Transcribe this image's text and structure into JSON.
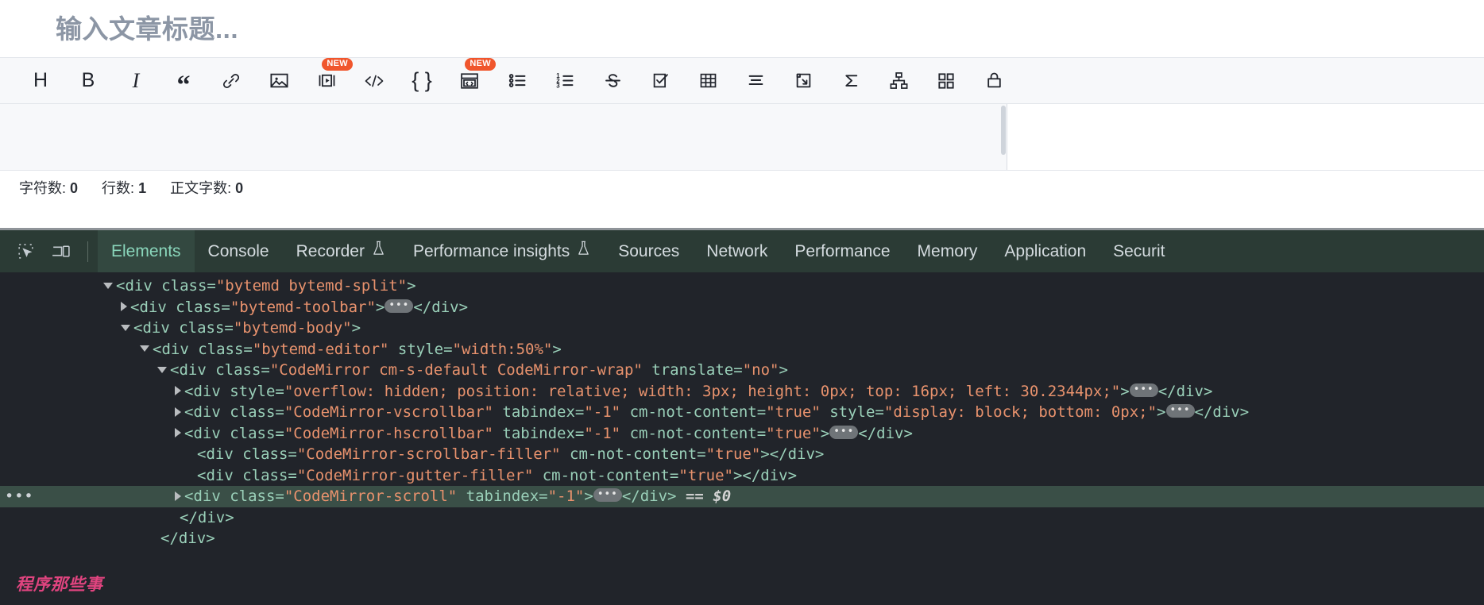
{
  "editor": {
    "title_placeholder": "输入文章标题...",
    "toolbar": [
      {
        "name": "heading",
        "glyph": "H",
        "style": "sans",
        "badge": ""
      },
      {
        "name": "bold",
        "glyph": "B",
        "style": "sans bold",
        "badge": ""
      },
      {
        "name": "italic",
        "glyph": "I",
        "style": "italic",
        "badge": ""
      },
      {
        "name": "blockquote",
        "glyph": "“",
        "style": "quote",
        "badge": ""
      },
      {
        "name": "link",
        "glyph": "",
        "style": "svg",
        "badge": ""
      },
      {
        "name": "image",
        "glyph": "",
        "style": "svg",
        "badge": ""
      },
      {
        "name": "video",
        "glyph": "",
        "style": "svg",
        "badge": "NEW"
      },
      {
        "name": "inline-code",
        "glyph": "</>",
        "style": "svg",
        "badge": ""
      },
      {
        "name": "braces",
        "glyph": "{ }",
        "style": "sans",
        "badge": ""
      },
      {
        "name": "code-block",
        "glyph": "",
        "style": "svg",
        "badge": "NEW"
      },
      {
        "name": "bullet-list",
        "glyph": "",
        "style": "svg",
        "badge": ""
      },
      {
        "name": "ordered-list",
        "glyph": "",
        "style": "svg",
        "badge": ""
      },
      {
        "name": "strikethrough",
        "glyph": "S",
        "style": "svg",
        "badge": ""
      },
      {
        "name": "task-list",
        "glyph": "",
        "style": "svg",
        "badge": ""
      },
      {
        "name": "table",
        "glyph": "",
        "style": "svg",
        "badge": ""
      },
      {
        "name": "align-text",
        "glyph": "",
        "style": "svg",
        "badge": ""
      },
      {
        "name": "insert-page-break",
        "glyph": "",
        "style": "svg",
        "badge": ""
      },
      {
        "name": "formula",
        "glyph": "Σ",
        "style": "svg",
        "badge": ""
      },
      {
        "name": "mind-map",
        "glyph": "",
        "style": "svg",
        "badge": ""
      },
      {
        "name": "grid-blocks",
        "glyph": "",
        "style": "svg",
        "badge": ""
      },
      {
        "name": "lock",
        "glyph": "",
        "style": "svg",
        "badge": ""
      }
    ],
    "status": {
      "chars_label": "字符数:",
      "chars_value": "0",
      "lines_label": "行数:",
      "lines_value": "1",
      "words_label": "正文字数:",
      "words_value": "0"
    }
  },
  "devtools": {
    "tabs": [
      {
        "label": "Elements",
        "active": true,
        "flask": false
      },
      {
        "label": "Console",
        "active": false,
        "flask": false
      },
      {
        "label": "Recorder",
        "active": false,
        "flask": true
      },
      {
        "label": "Performance insights",
        "active": false,
        "flask": true
      },
      {
        "label": "Sources",
        "active": false,
        "flask": false
      },
      {
        "label": "Network",
        "active": false,
        "flask": false
      },
      {
        "label": "Performance",
        "active": false,
        "flask": false
      },
      {
        "label": "Memory",
        "active": false,
        "flask": false
      },
      {
        "label": "Application",
        "active": false,
        "flask": false
      },
      {
        "label": "Securit",
        "active": false,
        "flask": false
      }
    ],
    "gutter_dots": "•••",
    "tree": [
      {
        "indent": 130,
        "marker": "open",
        "selected": false,
        "parts": [
          {
            "t": "punct",
            "s": "<"
          },
          {
            "t": "tag",
            "s": "div"
          },
          {
            "t": "attr",
            "s": " class="
          },
          {
            "t": "val",
            "s": "\"bytemd bytemd-split\""
          },
          {
            "t": "punct",
            "s": ">"
          }
        ]
      },
      {
        "indent": 152,
        "marker": "closed",
        "selected": false,
        "parts": [
          {
            "t": "punct",
            "s": "<"
          },
          {
            "t": "tag",
            "s": "div"
          },
          {
            "t": "attr",
            "s": " class="
          },
          {
            "t": "val",
            "s": "\"bytemd-toolbar\""
          },
          {
            "t": "punct",
            "s": ">"
          },
          {
            "t": "pill",
            "s": "…"
          },
          {
            "t": "punct",
            "s": "</"
          },
          {
            "t": "tag",
            "s": "div"
          },
          {
            "t": "punct",
            "s": ">"
          }
        ]
      },
      {
        "indent": 152,
        "marker": "open",
        "selected": false,
        "parts": [
          {
            "t": "punct",
            "s": "<"
          },
          {
            "t": "tag",
            "s": "div"
          },
          {
            "t": "attr",
            "s": " class="
          },
          {
            "t": "val",
            "s": "\"bytemd-body\""
          },
          {
            "t": "punct",
            "s": ">"
          }
        ]
      },
      {
        "indent": 176,
        "marker": "open",
        "selected": false,
        "parts": [
          {
            "t": "punct",
            "s": "<"
          },
          {
            "t": "tag",
            "s": "div"
          },
          {
            "t": "attr",
            "s": " class="
          },
          {
            "t": "val",
            "s": "\"bytemd-editor\""
          },
          {
            "t": "attr",
            "s": " style="
          },
          {
            "t": "val",
            "s": "\"width:50%\""
          },
          {
            "t": "punct",
            "s": ">"
          }
        ]
      },
      {
        "indent": 198,
        "marker": "open",
        "selected": false,
        "parts": [
          {
            "t": "punct",
            "s": "<"
          },
          {
            "t": "tag",
            "s": "div"
          },
          {
            "t": "attr",
            "s": " class="
          },
          {
            "t": "val",
            "s": "\"CodeMirror cm-s-default CodeMirror-wrap\""
          },
          {
            "t": "attr",
            "s": " translate="
          },
          {
            "t": "val",
            "s": "\"no\""
          },
          {
            "t": "punct",
            "s": ">"
          }
        ]
      },
      {
        "indent": 220,
        "marker": "closed",
        "selected": false,
        "parts": [
          {
            "t": "punct",
            "s": "<"
          },
          {
            "t": "tag",
            "s": "div"
          },
          {
            "t": "attr",
            "s": " style="
          },
          {
            "t": "val",
            "s": "\"overflow: hidden; position: relative; width: 3px; height: 0px; top: 16px; left: 30.2344px;\""
          },
          {
            "t": "punct",
            "s": ">"
          },
          {
            "t": "pill",
            "s": "…"
          },
          {
            "t": "punct",
            "s": "</"
          },
          {
            "t": "tag",
            "s": "div"
          },
          {
            "t": "punct",
            "s": ">"
          }
        ]
      },
      {
        "indent": 220,
        "marker": "closed",
        "selected": false,
        "parts": [
          {
            "t": "punct",
            "s": "<"
          },
          {
            "t": "tag",
            "s": "div"
          },
          {
            "t": "attr",
            "s": " class="
          },
          {
            "t": "val",
            "s": "\"CodeMirror-vscrollbar\""
          },
          {
            "t": "attr",
            "s": " tabindex="
          },
          {
            "t": "val",
            "s": "\"-1\""
          },
          {
            "t": "attr",
            "s": " cm-not-content="
          },
          {
            "t": "val",
            "s": "\"true\""
          },
          {
            "t": "attr",
            "s": " style="
          },
          {
            "t": "val",
            "s": "\"display: block; bottom: 0px;\""
          },
          {
            "t": "punct",
            "s": ">"
          },
          {
            "t": "pill",
            "s": "…"
          },
          {
            "t": "punct",
            "s": "</"
          },
          {
            "t": "tag",
            "s": "div"
          },
          {
            "t": "punct",
            "s": ">"
          }
        ]
      },
      {
        "indent": 220,
        "marker": "closed",
        "selected": false,
        "parts": [
          {
            "t": "punct",
            "s": "<"
          },
          {
            "t": "tag",
            "s": "div"
          },
          {
            "t": "attr",
            "s": " class="
          },
          {
            "t": "val",
            "s": "\"CodeMirror-hscrollbar\""
          },
          {
            "t": "attr",
            "s": " tabindex="
          },
          {
            "t": "val",
            "s": "\"-1\""
          },
          {
            "t": "attr",
            "s": " cm-not-content="
          },
          {
            "t": "val",
            "s": "\"true\""
          },
          {
            "t": "punct",
            "s": ">"
          },
          {
            "t": "pill",
            "s": "…"
          },
          {
            "t": "punct",
            "s": "</"
          },
          {
            "t": "tag",
            "s": "div"
          },
          {
            "t": "punct",
            "s": ">"
          }
        ]
      },
      {
        "indent": 232,
        "marker": "none",
        "selected": false,
        "parts": [
          {
            "t": "punct",
            "s": "<"
          },
          {
            "t": "tag",
            "s": "div"
          },
          {
            "t": "attr",
            "s": " class="
          },
          {
            "t": "val",
            "s": "\"CodeMirror-scrollbar-filler\""
          },
          {
            "t": "attr",
            "s": " cm-not-content="
          },
          {
            "t": "val",
            "s": "\"true\""
          },
          {
            "t": "punct",
            "s": "></"
          },
          {
            "t": "tag",
            "s": "div"
          },
          {
            "t": "punct",
            "s": ">"
          }
        ]
      },
      {
        "indent": 232,
        "marker": "none",
        "selected": false,
        "parts": [
          {
            "t": "punct",
            "s": "<"
          },
          {
            "t": "tag",
            "s": "div"
          },
          {
            "t": "attr",
            "s": " class="
          },
          {
            "t": "val",
            "s": "\"CodeMirror-gutter-filler\""
          },
          {
            "t": "attr",
            "s": " cm-not-content="
          },
          {
            "t": "val",
            "s": "\"true\""
          },
          {
            "t": "punct",
            "s": "></"
          },
          {
            "t": "tag",
            "s": "div"
          },
          {
            "t": "punct",
            "s": ">"
          }
        ]
      },
      {
        "indent": 220,
        "marker": "closed",
        "selected": true,
        "parts": [
          {
            "t": "punct",
            "s": "<"
          },
          {
            "t": "tag",
            "s": "div"
          },
          {
            "t": "attr",
            "s": " class="
          },
          {
            "t": "val",
            "s": "\"CodeMirror-scroll\""
          },
          {
            "t": "attr",
            "s": " tabindex="
          },
          {
            "t": "val",
            "s": "\"-1\""
          },
          {
            "t": "punct",
            "s": ">"
          },
          {
            "t": "pill",
            "s": "…"
          },
          {
            "t": "punct",
            "s": "</"
          },
          {
            "t": "tag",
            "s": "div"
          },
          {
            "t": "punct",
            "s": ">"
          },
          {
            "t": "eq0",
            "s": " == "
          },
          {
            "t": "dollar",
            "s": "$0"
          }
        ]
      },
      {
        "indent": 210,
        "marker": "none",
        "selected": false,
        "parts": [
          {
            "t": "punct",
            "s": "</"
          },
          {
            "t": "tag",
            "s": "div"
          },
          {
            "t": "punct",
            "s": ">"
          }
        ]
      },
      {
        "indent": 186,
        "marker": "none",
        "selected": false,
        "parts": [
          {
            "t": "punct",
            "s": "</"
          },
          {
            "t": "tag",
            "s": "div"
          },
          {
            "t": "punct",
            "s": ">"
          }
        ]
      }
    ],
    "watermark": "程序那些事"
  }
}
